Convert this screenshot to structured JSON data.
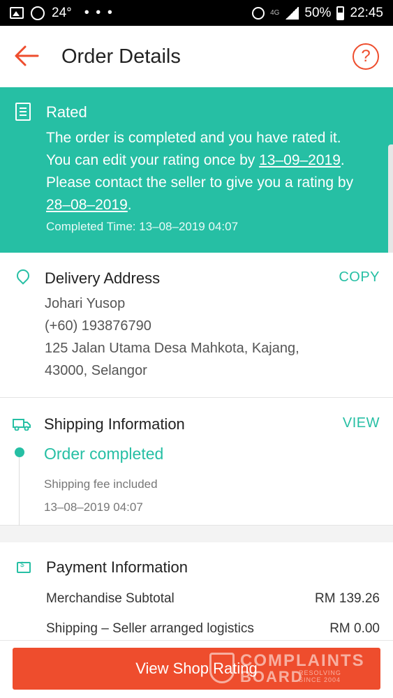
{
  "status_bar": {
    "temp": "24°",
    "dots": "• • •",
    "net": "4G",
    "battery": "50%",
    "time": "22:45"
  },
  "header": {
    "title": "Order Details",
    "help": "?"
  },
  "banner": {
    "title": "Rated",
    "line1": "The order is completed and you have rated it.",
    "line2_pre": "You can edit your rating once by ",
    "line2_date": "13–09–2019",
    "line2_post": ".",
    "line3": "Please contact the seller to give you a rating by",
    "line4_date": "28–08–2019",
    "line4_post": ".",
    "completed_time": "Completed Time: 13–08–2019 04:07"
  },
  "address": {
    "title": "Delivery Address",
    "copy": "COPY",
    "name": "Johari Yusop",
    "phone": "(+60) 193876790",
    "line1": "125 Jalan Utama Desa Mahkota, Kajang,",
    "line2": "43000, Selangor"
  },
  "shipping": {
    "title": "Shipping Information",
    "view": "VIEW",
    "status": "Order completed",
    "note": "Shipping fee included",
    "time": "13–08–2019 04:07"
  },
  "payment": {
    "title": "Payment Information",
    "rows": [
      {
        "label": "Merchandise Subtotal",
        "value": "RM 139.26"
      },
      {
        "label": "Shipping – Seller arranged logistics",
        "value": "RM 0.00"
      }
    ]
  },
  "cta": {
    "label": "View Shop Rating"
  },
  "watermark": {
    "l1": "COMPLAINTS",
    "l2": "BOARD",
    "l3": "RESOLVING",
    "l4": "SINCE 2004"
  },
  "colors": {
    "accent": "#ee4d2d",
    "teal": "#26bfa4"
  }
}
